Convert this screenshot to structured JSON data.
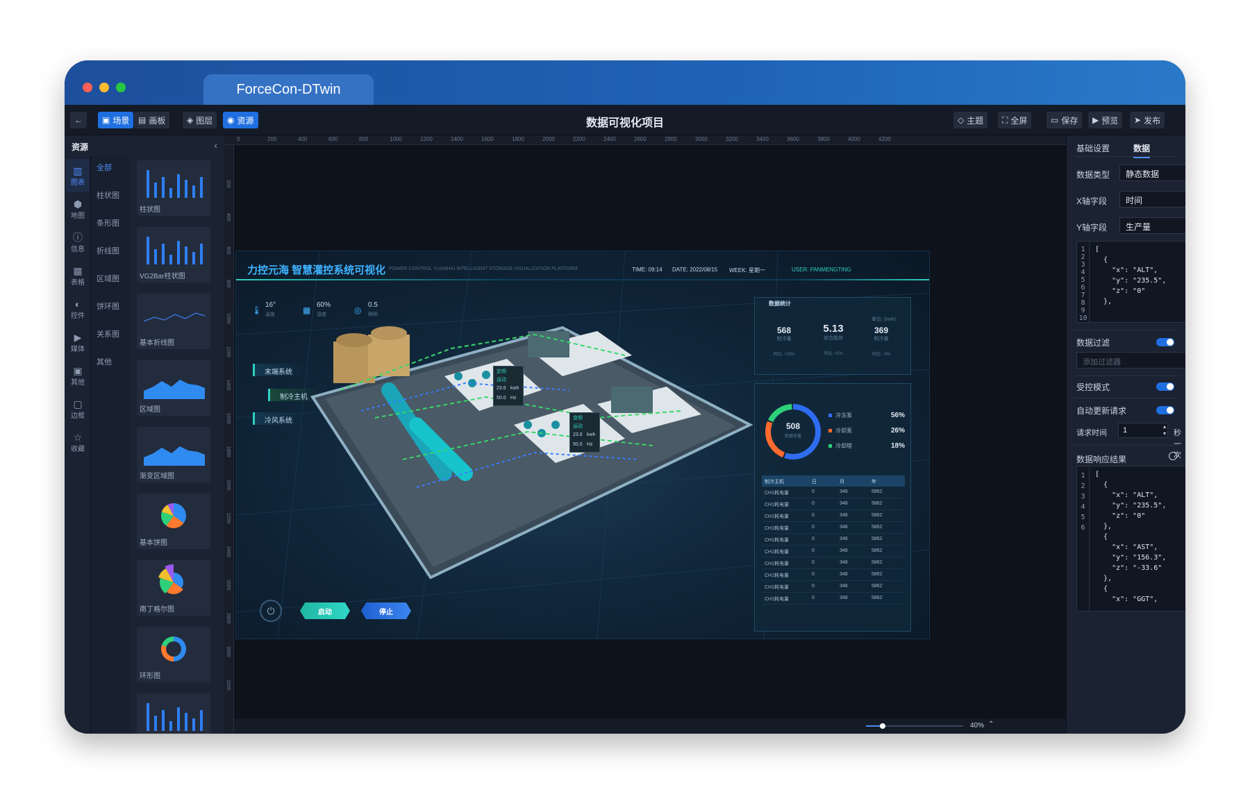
{
  "window": {
    "tab_title": "ForceCon-DTwin",
    "traffic_lights": [
      "#ff5f57",
      "#febc2e",
      "#28c840"
    ]
  },
  "toolbar": {
    "back_icon": "arrow-left-icon",
    "scene_label": "场景",
    "panel_label": "画板",
    "layers_label": "图层",
    "assets_label": "资源",
    "title": "数据可视化项目",
    "theme_label": "主题",
    "fullscreen_label": "全屏",
    "save_label": "保存",
    "preview_label": "预览",
    "publish_label": "发布"
  },
  "assets": {
    "header": "资源",
    "collapse_icon": "chevron-left-icon",
    "nav": [
      {
        "label": "图表",
        "icon": "bar-chart-icon"
      },
      {
        "label": "地图",
        "icon": "map-icon"
      },
      {
        "label": "信息",
        "icon": "info-icon"
      },
      {
        "label": "表格",
        "icon": "table-icon"
      },
      {
        "label": "控件",
        "icon": "control-icon"
      },
      {
        "label": "媒体",
        "icon": "media-icon"
      },
      {
        "label": "其他",
        "icon": "other-icon"
      },
      {
        "label": "边框",
        "icon": "border-icon"
      },
      {
        "label": "收藏",
        "icon": "star-icon"
      }
    ],
    "categories": [
      "全部",
      "柱状图",
      "条形图",
      "折线图",
      "区域图",
      "饼环图",
      "关系图",
      "其他"
    ],
    "thumbs": [
      "柱状图",
      "VG2Bar柱状图",
      "基本折线图",
      "区域图",
      "渐变区域图",
      "基本饼图",
      "南丁格尔图",
      "环形图",
      ""
    ]
  },
  "ruler": {
    "top": [
      "0",
      "200",
      "400",
      "600",
      "800",
      "1000",
      "1200",
      "1400",
      "1600",
      "1800",
      "2000",
      "2200",
      "2400",
      "2600",
      "2800",
      "3000",
      "3200",
      "3400",
      "3600",
      "3800",
      "4000",
      "4200"
    ],
    "left": [
      "200",
      "400",
      "600",
      "800",
      "1000",
      "1200",
      "1400",
      "1600",
      "1800",
      "2000",
      "2200",
      "2400",
      "2600",
      "2800",
      "3000",
      "3200"
    ]
  },
  "stage": {
    "title": "力控元海 智慧灌控系统可视化",
    "subtitle": "POWER CONTROL YUANHAI INTELLIGENT STORAGE VISUALIZATION PLATFORM",
    "time": "TIME: 09:14",
    "date": "DATE: 2022/08/15",
    "week": "WEEK: 星期一",
    "user": "USER: PANMENGTING",
    "env": [
      {
        "value": "16°",
        "label": "温度"
      },
      {
        "value": "60%",
        "label": "湿度"
      },
      {
        "value": "0.5",
        "label": "照明"
      }
    ],
    "systems": [
      "末端系统",
      "制冷主机",
      "冷风系统"
    ],
    "tags": [
      {
        "l1": "定频",
        "l2": "运动",
        "l3": "23.6",
        "l4": "kwh",
        "l5": "50.0",
        "l6": "Hz"
      },
      {
        "l1": "变频",
        "l2": "运动",
        "l3": "23.6",
        "l4": "kwh",
        "l5": "50.0",
        "l6": "Hz"
      }
    ],
    "start_label": "启动",
    "stop_label": "停止",
    "power_icon": "power-icon",
    "stats_title": "数据统计",
    "stats_unit": "单位: (kwh)",
    "stats": [
      {
        "value": "568",
        "label": "制冷量",
        "sub": "同比: +15%"
      },
      {
        "value": "5.13",
        "label": "综合能效",
        "sub": "同比: +5%"
      },
      {
        "value": "369",
        "label": "制冷量",
        "sub": "同比: -5%"
      }
    ],
    "donut": {
      "total": "508",
      "total_label": "数据总量",
      "items": [
        {
          "label": "冷冻泵",
          "value": "56%",
          "color": "#2f6cf0"
        },
        {
          "label": "冷却泵",
          "value": "26%",
          "color": "#ff6a2e"
        },
        {
          "label": "冷却塔",
          "value": "18%",
          "color": "#2fd07a"
        }
      ]
    },
    "table": {
      "headers": [
        "制冷主机",
        "日",
        "月",
        "年"
      ],
      "rows": [
        [
          "CH1耗电量",
          "0",
          "348",
          "5862"
        ],
        [
          "CH1耗电量",
          "0",
          "348",
          "5862"
        ],
        [
          "CH1耗电量",
          "0",
          "348",
          "5862"
        ],
        [
          "CH1耗电量",
          "0",
          "348",
          "5862"
        ],
        [
          "CH1耗电量",
          "0",
          "348",
          "5862"
        ],
        [
          "CH1耗电量",
          "0",
          "348",
          "5862"
        ],
        [
          "CH1耗电量",
          "0",
          "348",
          "5862"
        ],
        [
          "CH1耗电量",
          "0",
          "348",
          "5862"
        ],
        [
          "CH1耗电量",
          "0",
          "348",
          "5862"
        ],
        [
          "CH1耗电量",
          "0",
          "348",
          "5862"
        ]
      ]
    }
  },
  "status": {
    "zoom": "40%",
    "zoom_fraction": 0.17
  },
  "right": {
    "tab_basic": "基础设置",
    "tab_data": "数据",
    "data_type_label": "数据类型",
    "data_type_value": "静态数据",
    "x_label": "X轴字段",
    "x_value": "时间",
    "y_label": "Y轴字段",
    "y_value": "生产量",
    "code1_lines": [
      "1",
      "2",
      "3",
      "4",
      "5",
      "6",
      "7",
      "8",
      "9",
      "10"
    ],
    "code1": "[\n  {\n    \"x\": \"ALT\",\n    \"y\": \"235.5\",\n    \"z\": \"0\"\n  },",
    "filter_label": "数据过滤",
    "filter_placeholder": "添加过滤器",
    "controlled_label": "受控模式",
    "auto_update_label": "自动更新请求",
    "interval_label": "请求时间",
    "interval_value": "1",
    "interval_unit": "秒一次",
    "response_label": "数据响应结果",
    "code2_lines": [
      "1",
      "2",
      "3",
      "4",
      "5",
      "6"
    ],
    "code2": "[\n  {\n    \"x\": \"ALT\",\n    \"y\": \"235.5\",\n    \"z\": \"0\"\n  },\n  {\n    \"x\": \"AST\",\n    \"y\": \"156.3\",\n    \"z\": \"-33.6\"\n  },\n  {\n    \"x\": \"GGT\","
  }
}
